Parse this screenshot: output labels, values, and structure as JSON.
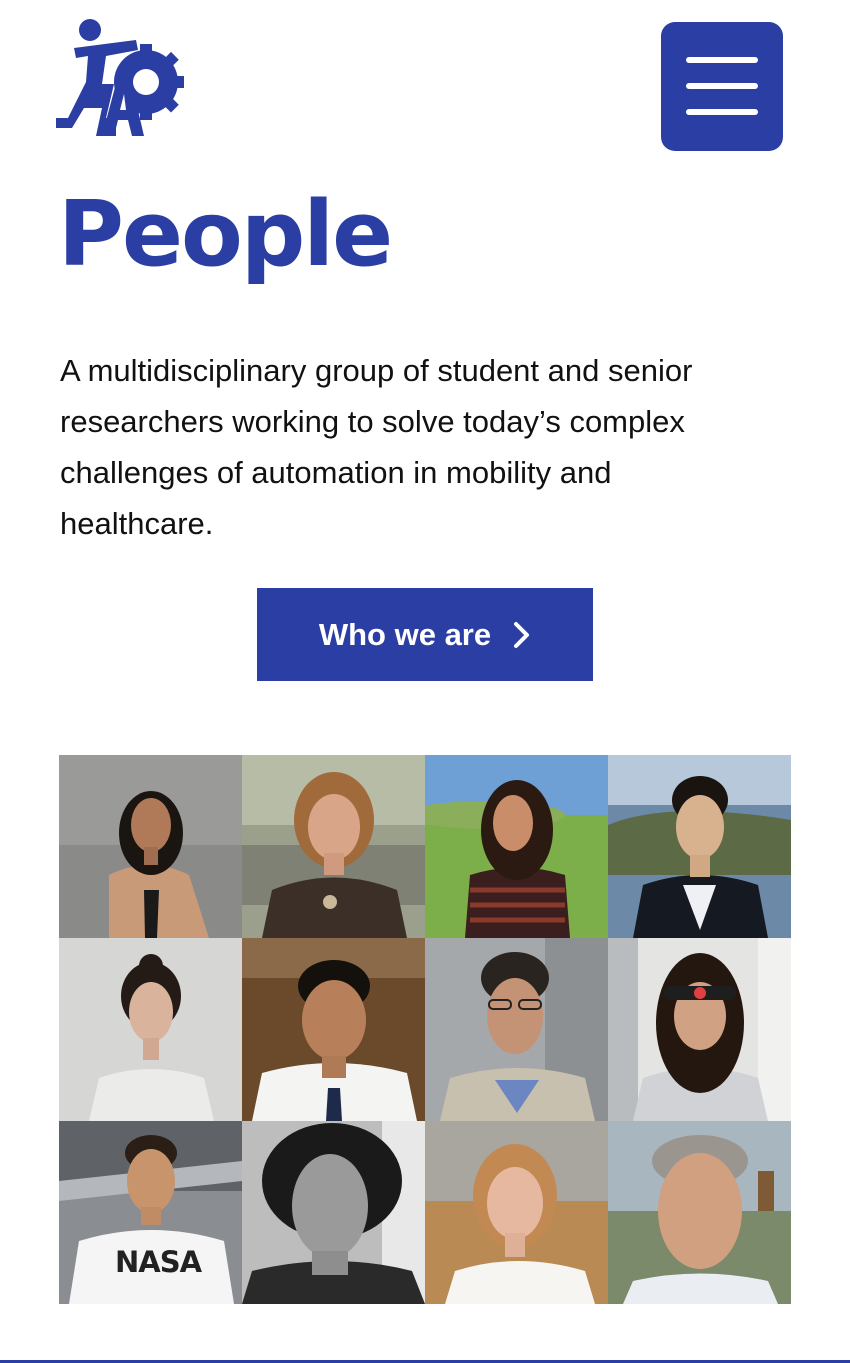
{
  "brand": {
    "logo_text": "IAP",
    "accent_color": "#2b3ea4"
  },
  "header": {
    "menu_icon": "hamburger-menu-icon"
  },
  "main": {
    "title": "People",
    "intro": "A multidisciplinary group of student and senior researchers working to solve today’s complex challenges of automation in mobility and healthcare.",
    "cta": {
      "label": "Who we are",
      "icon": "chevron-right-icon"
    }
  },
  "photos": {
    "rows": 3,
    "columns": 4,
    "items": [
      {
        "id": 1,
        "overlay_text": ""
      },
      {
        "id": 2,
        "overlay_text": ""
      },
      {
        "id": 3,
        "overlay_text": ""
      },
      {
        "id": 4,
        "overlay_text": ""
      },
      {
        "id": 5,
        "overlay_text": ""
      },
      {
        "id": 6,
        "overlay_text": ""
      },
      {
        "id": 7,
        "overlay_text": ""
      },
      {
        "id": 8,
        "overlay_text": ""
      },
      {
        "id": 9,
        "overlay_text": "NASA"
      },
      {
        "id": 10,
        "overlay_text": ""
      },
      {
        "id": 11,
        "overlay_text": ""
      },
      {
        "id": 12,
        "overlay_text": ""
      }
    ]
  }
}
